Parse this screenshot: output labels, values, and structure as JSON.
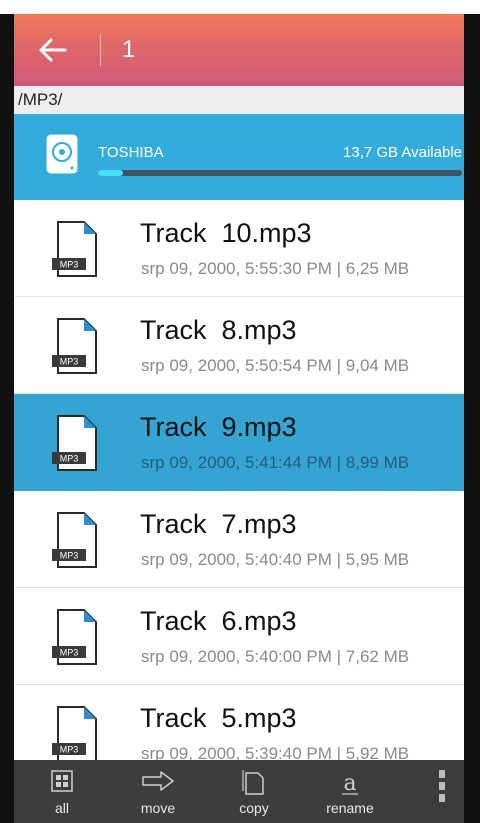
{
  "header": {
    "title": "1",
    "back_icon": "arrow-left-icon"
  },
  "path": "/MP3/",
  "storage": {
    "name": "TOSHIBA",
    "available": "13,7 GB Available",
    "used_fraction": 0.07,
    "icon": "hard-drive-icon"
  },
  "files": [
    {
      "name": "Track  10.mp3",
      "meta": "srp 09, 2000, 5:55:30 PM | 6,25 MB",
      "icon_label": "MP3",
      "selected": false
    },
    {
      "name": "Track  8.mp3",
      "meta": "srp 09, 2000, 5:50:54 PM | 9,04 MB",
      "icon_label": "MP3",
      "selected": false
    },
    {
      "name": "Track  9.mp3",
      "meta": "srp 09, 2000, 5:41:44 PM | 8,99 MB",
      "icon_label": "MP3",
      "selected": true
    },
    {
      "name": "Track  7.mp3",
      "meta": "srp 09, 2000, 5:40:40 PM | 5,95 MB",
      "icon_label": "MP3",
      "selected": false
    },
    {
      "name": "Track  6.mp3",
      "meta": "srp 09, 2000, 5:40:00 PM | 7,62 MB",
      "icon_label": "MP3",
      "selected": false
    },
    {
      "name": "Track  5.mp3",
      "meta": "srp 09, 2000, 5:39:40 PM | 5,92 MB",
      "icon_label": "MP3",
      "selected": false
    }
  ],
  "toolbar": {
    "all": "all",
    "move": "move",
    "copy": "copy",
    "rename": "rename",
    "more_icon": "more-vertical-icon"
  },
  "colors": {
    "header_top": "#f07a57",
    "header_bottom": "#d0597a",
    "storage_bg": "#33abdb",
    "selected_row": "#34a4d3",
    "toolbar_bg": "#3d3d3d",
    "progress_fill": "#46dff2"
  }
}
